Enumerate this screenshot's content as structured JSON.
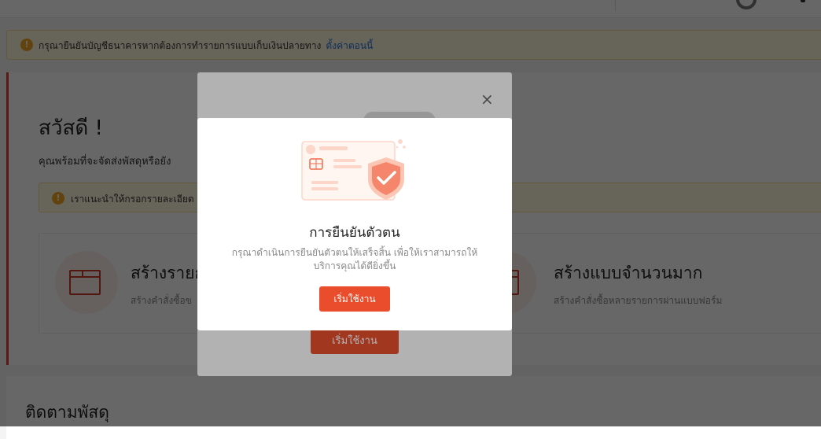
{
  "banner": {
    "text": "กรุณายืนยันบัญชีธนาคารหากต้องการทำรายการแบบเก็บเงินปลายทาง",
    "link": "ตั้งค่าตอนนี้"
  },
  "welcome": {
    "title": "สวัสดี !",
    "subtitle": "คุณพร้อมที่จะจัดส่งพัสดุหรือยัง",
    "tip": "เราแนะนำให้กรอกรายละเอียด"
  },
  "options": {
    "single": {
      "title": "สร้างรายก",
      "desc": "สร้างคำสั่งซื้อข"
    },
    "bulk": {
      "title": "สร้างแบบจำนวนมาก",
      "desc": "สร้างคำสั่งซื้อหลายรายการผ่านแบบฟอร์ม"
    }
  },
  "tracking": {
    "title": "ติดตามพัสดุ"
  },
  "back_modal": {
    "close": "×",
    "button": "เริ่มใช้งาน"
  },
  "modal": {
    "title": "การยืนยันตัวตน",
    "desc": "กรุณาดำเนินการยืนยันตัวตนให้เสร็จสิ้น เพื่อให้เราสามารถให้บริการคุณได้ดียิ่งขึ้น",
    "button": "เริ่มใช้งาน"
  },
  "colors": {
    "accent": "#ea4d2c",
    "link": "#2673dd",
    "warning": "#f5a623"
  }
}
